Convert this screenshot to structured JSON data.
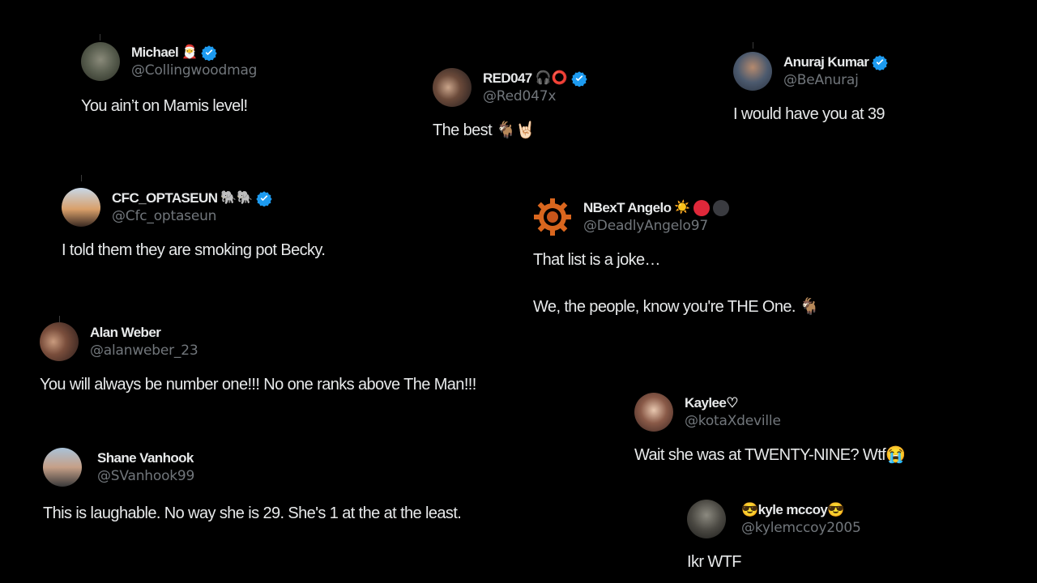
{
  "tweets": [
    {
      "name": "Michael",
      "name_emoji": "🎅",
      "verified": true,
      "handle": "@Collingwoodmag",
      "text": "You ain’t on Mamis level!",
      "avatar_icon": "avatar-photo"
    },
    {
      "name": "RED047",
      "name_emoji": "🎧⭕",
      "verified": true,
      "handle": "@Red047x",
      "text": "The best 🐐🤘🏻",
      "avatar_icon": "avatar-photo"
    },
    {
      "name": "Anuraj Kumar",
      "name_emoji": "",
      "verified": true,
      "handle": "@BeAnuraj",
      "text": "I would have you at 39",
      "avatar_icon": "avatar-photo"
    },
    {
      "name": "CFC_OPTASEUN",
      "name_emoji": "🐘🐘",
      "verified": true,
      "handle": "@Cfc_optaseun",
      "text": "I told them they are smoking pot Becky.",
      "avatar_icon": "avatar-photo"
    },
    {
      "name": "NBexT Angelo",
      "name_emoji": "☀️",
      "verified": false,
      "handle": "@DeadlyAngelo97",
      "text_line1": "That list is a joke…",
      "text_line2": "We, the people, know you're THE One.  🐐",
      "avatar_icon": "gear-logo-icon"
    },
    {
      "name": "Alan Weber",
      "name_emoji": "",
      "verified": false,
      "handle": "@alanweber_23",
      "text": "You will always be number one!!! No one ranks above The Man!!!",
      "avatar_icon": "avatar-photo"
    },
    {
      "name": "Kaylee♡",
      "name_emoji": "",
      "verified": false,
      "handle": "@kotaXdeville",
      "text": "Wait she was at TWENTY-NINE? Wtf😭",
      "avatar_icon": "avatar-photo"
    },
    {
      "name": "Shane Vanhook",
      "name_emoji": "",
      "verified": false,
      "handle": "@SVanhook99",
      "text": "This is laughable. No way she is 29. She's 1 at the at the least.",
      "avatar_icon": "avatar-photo"
    },
    {
      "name": "😎kyle mccoy😎",
      "name_emoji": "",
      "verified": false,
      "handle": "@kylemccoy2005",
      "text": "Ikr WTF",
      "avatar_icon": "avatar-photo"
    }
  ],
  "colors": {
    "background": "#000000",
    "text": "#e7e9ea",
    "handle": "#71767b",
    "verified": "#1d9bf0",
    "red_dot": "#e0283a",
    "dark_dot": "#3a3b40"
  }
}
